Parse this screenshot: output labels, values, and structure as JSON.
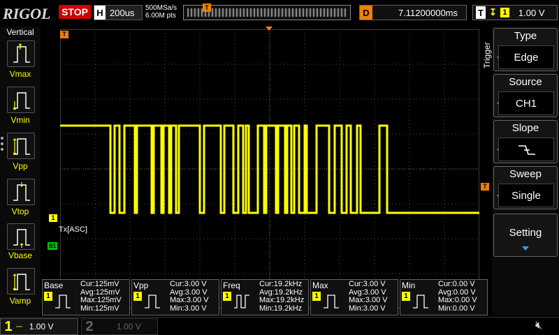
{
  "brand": "RIGOL",
  "run_state": "STOP",
  "timebase": {
    "label": "H",
    "value": "200us"
  },
  "acquisition": {
    "sample_rate": "500MSa/s",
    "points": "6.00M pts"
  },
  "memory_marker": "T",
  "delay": {
    "label": "D",
    "value": "7.11200000ms"
  },
  "trigger_status": {
    "label": "T",
    "channel": "1",
    "level": "1.00 V"
  },
  "left_menu": {
    "title": "Vertical",
    "items": [
      {
        "label": "Vmax"
      },
      {
        "label": "Vmin"
      },
      {
        "label": "Vpp"
      },
      {
        "label": "Vtop"
      },
      {
        "label": "Vbase"
      },
      {
        "label": "Vamp"
      }
    ]
  },
  "right_menu": {
    "title": "Trigger",
    "items": [
      {
        "title": "Type",
        "value": "Edge"
      },
      {
        "title": "Source",
        "value": "CH1"
      },
      {
        "title": "Slope",
        "value": ""
      },
      {
        "title": "Sweep",
        "value": "Single"
      }
    ],
    "setting": "Setting"
  },
  "screen": {
    "decode_label": "Tx[ASC]",
    "channel_marker": "1",
    "bus_marker": "B1",
    "trigger_marker": "T",
    "level_marker": "T"
  },
  "measurements": [
    {
      "name": "Base",
      "cur": "Cur:125mV",
      "avg": "Avg:125mV",
      "max": "Max:125mV",
      "min": "Min:125mV"
    },
    {
      "name": "Vpp",
      "cur": "Cur:3.00 V",
      "avg": "Avg:3.00 V",
      "max": "Max:3.00 V",
      "min": "Min:3.00 V"
    },
    {
      "name": "Freq",
      "cur": "Cur:19.2kHz",
      "avg": "Avg:19.2kHz",
      "max": "Max:19.2kHz",
      "min": "Min:19.2kHz"
    },
    {
      "name": "Max",
      "cur": "Cur:3.00 V",
      "avg": "Avg:3.00 V",
      "max": "Max:3.00 V",
      "min": "Min:3.00 V"
    },
    {
      "name": "Min",
      "cur": "Cur:0.00 V",
      "avg": "Avg:0.00 V",
      "max": "Max:0.00 V",
      "min": "Min:0.00 V"
    }
  ],
  "channels": [
    {
      "number": "1",
      "scale": "1.00 V"
    },
    {
      "number": "2",
      "scale": "1.00 V"
    }
  ],
  "colors": {
    "ch1": "#ffff00",
    "bus": "#00c000",
    "accent": "#f08000",
    "stop": "#d00000"
  }
}
